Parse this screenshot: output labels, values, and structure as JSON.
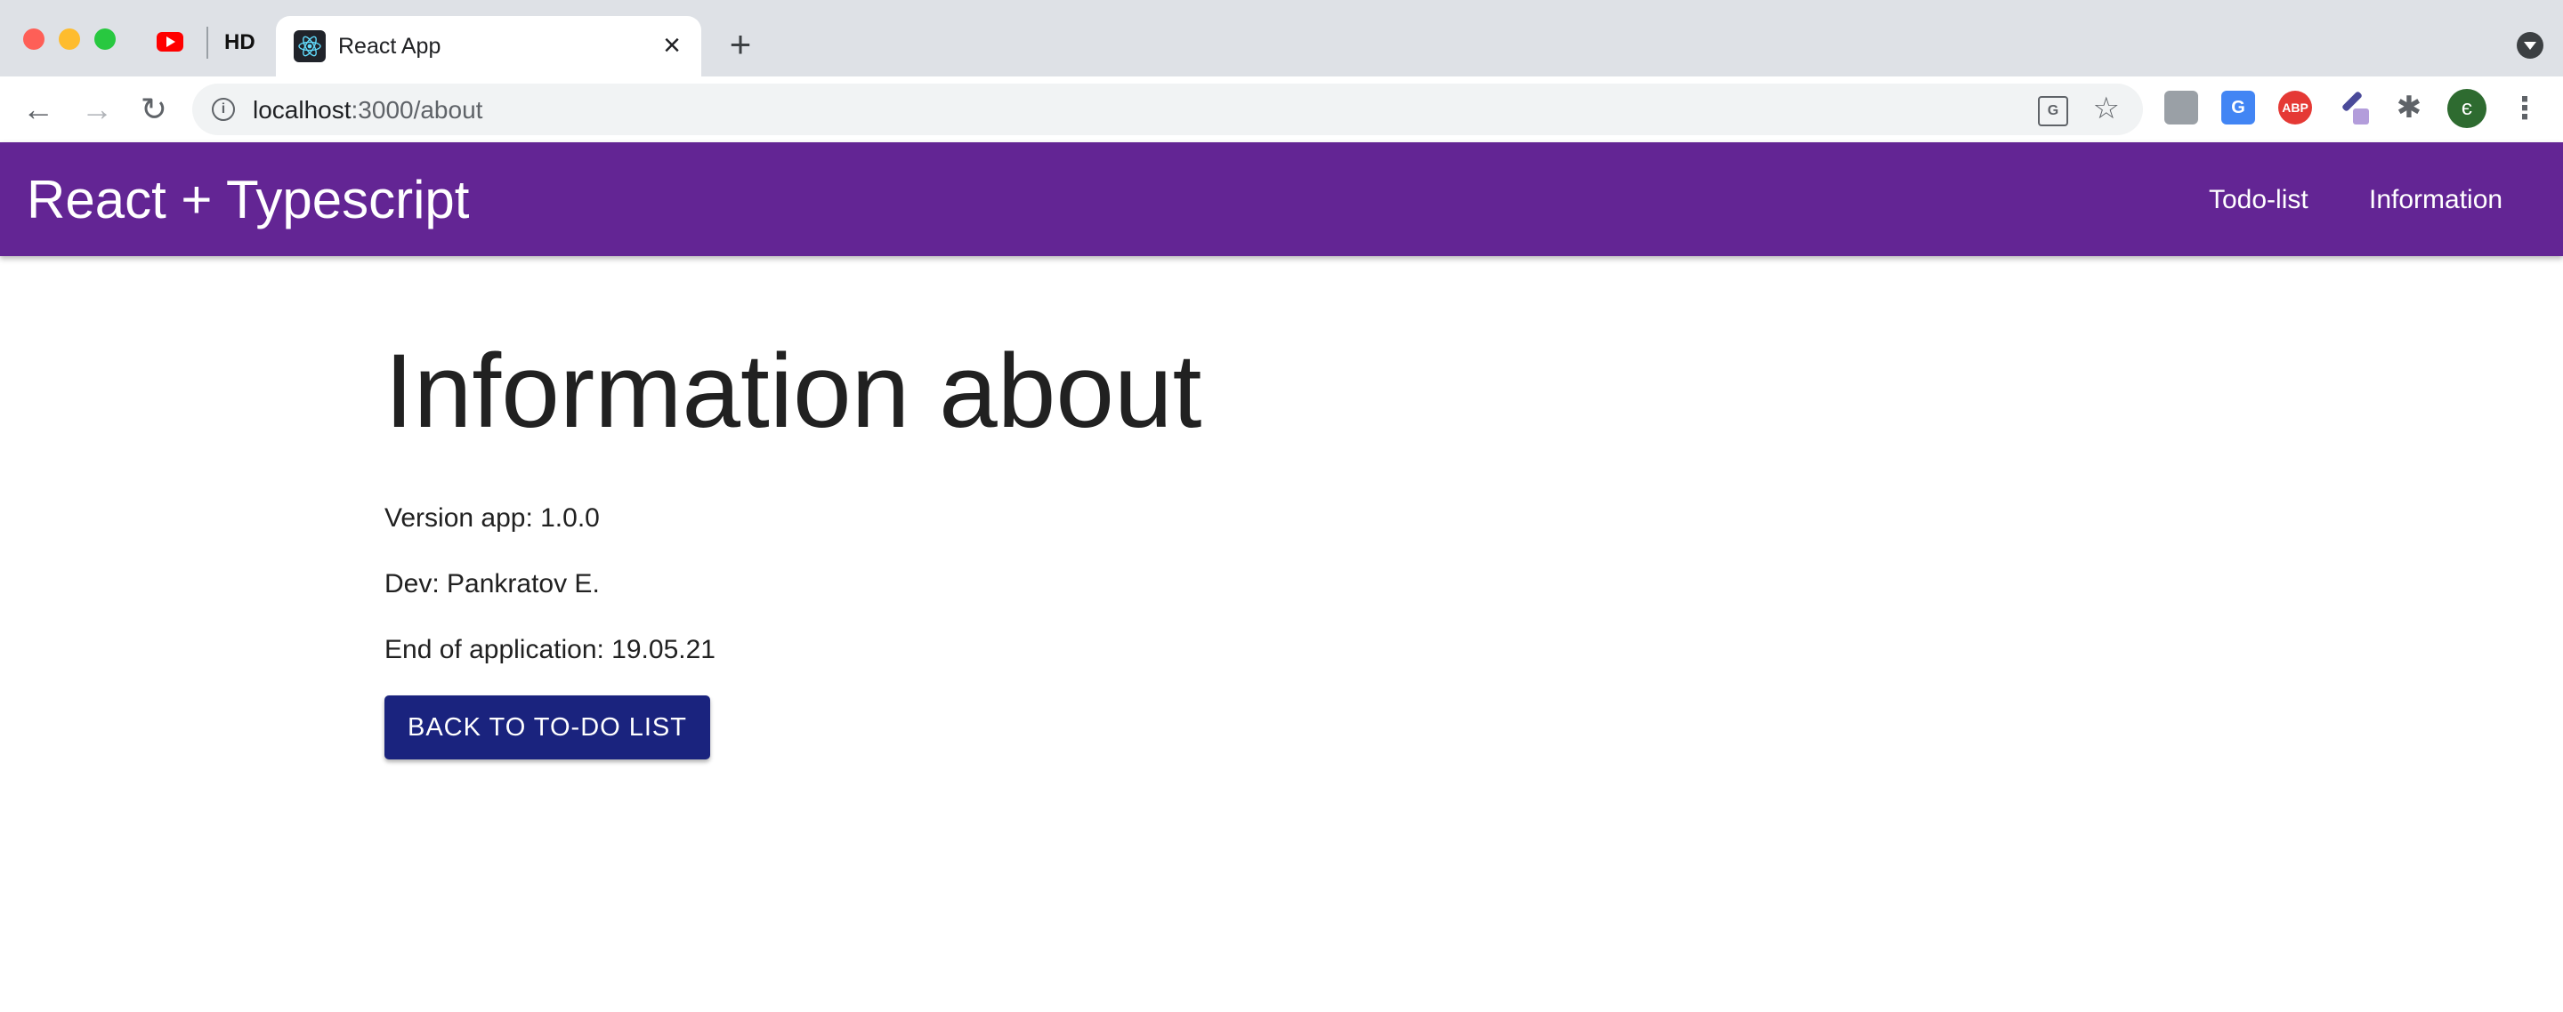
{
  "browser": {
    "tabs": [
      {
        "label": "",
        "icon": "youtube-icon"
      },
      {
        "label": "HD"
      },
      {
        "label": "React App",
        "icon": "react-icon"
      }
    ],
    "url_host": "localhost",
    "url_path": ":3000/about",
    "accent": "#dee1e6",
    "profile_initial": "є"
  },
  "appbar": {
    "title": "React + Typescript",
    "nav": [
      "Todo-list",
      "Information"
    ],
    "color": "#632594"
  },
  "main": {
    "heading": "Information about",
    "version": "Version app: 1.0.0",
    "dev": "Dev: Pankratov E.",
    "end": "End of application: 19.05.21",
    "back_button": "BACK TO TO-DO LIST",
    "button_color": "#1a237e"
  }
}
